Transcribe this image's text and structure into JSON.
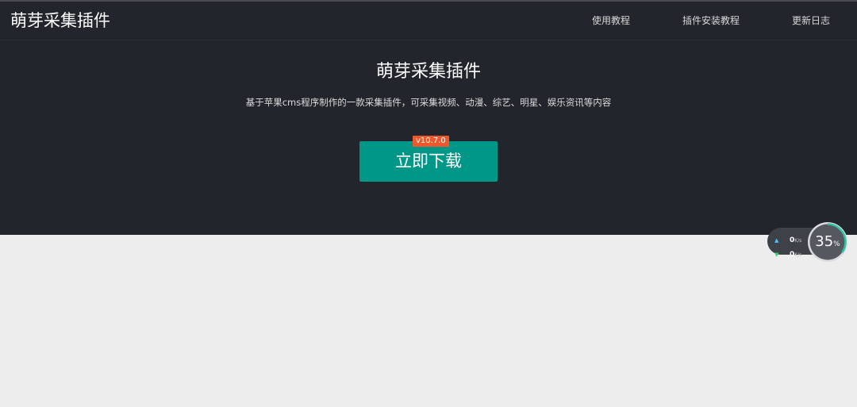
{
  "nav": {
    "brand": "萌芽采集插件",
    "links": [
      "使用教程",
      "插件安装教程",
      "更新日志"
    ]
  },
  "hero": {
    "title": "萌芽采集插件",
    "description": "基于苹果cms程序制作的一款采集插件，可采集视频、动漫、综艺、明星、娱乐资讯等内容",
    "download_label": "立即下载",
    "version": "v10.7.0"
  },
  "speed_widget": {
    "upload_value": "0",
    "upload_unit": "K/s",
    "download_value": "0",
    "download_unit": "K/s",
    "percent_value": "35",
    "percent_sign": "%",
    "percent": 35
  },
  "colors": {
    "header_bg": "#23252c",
    "accent": "#009789",
    "badge": "#f0582c",
    "body_bg": "#ededed"
  }
}
